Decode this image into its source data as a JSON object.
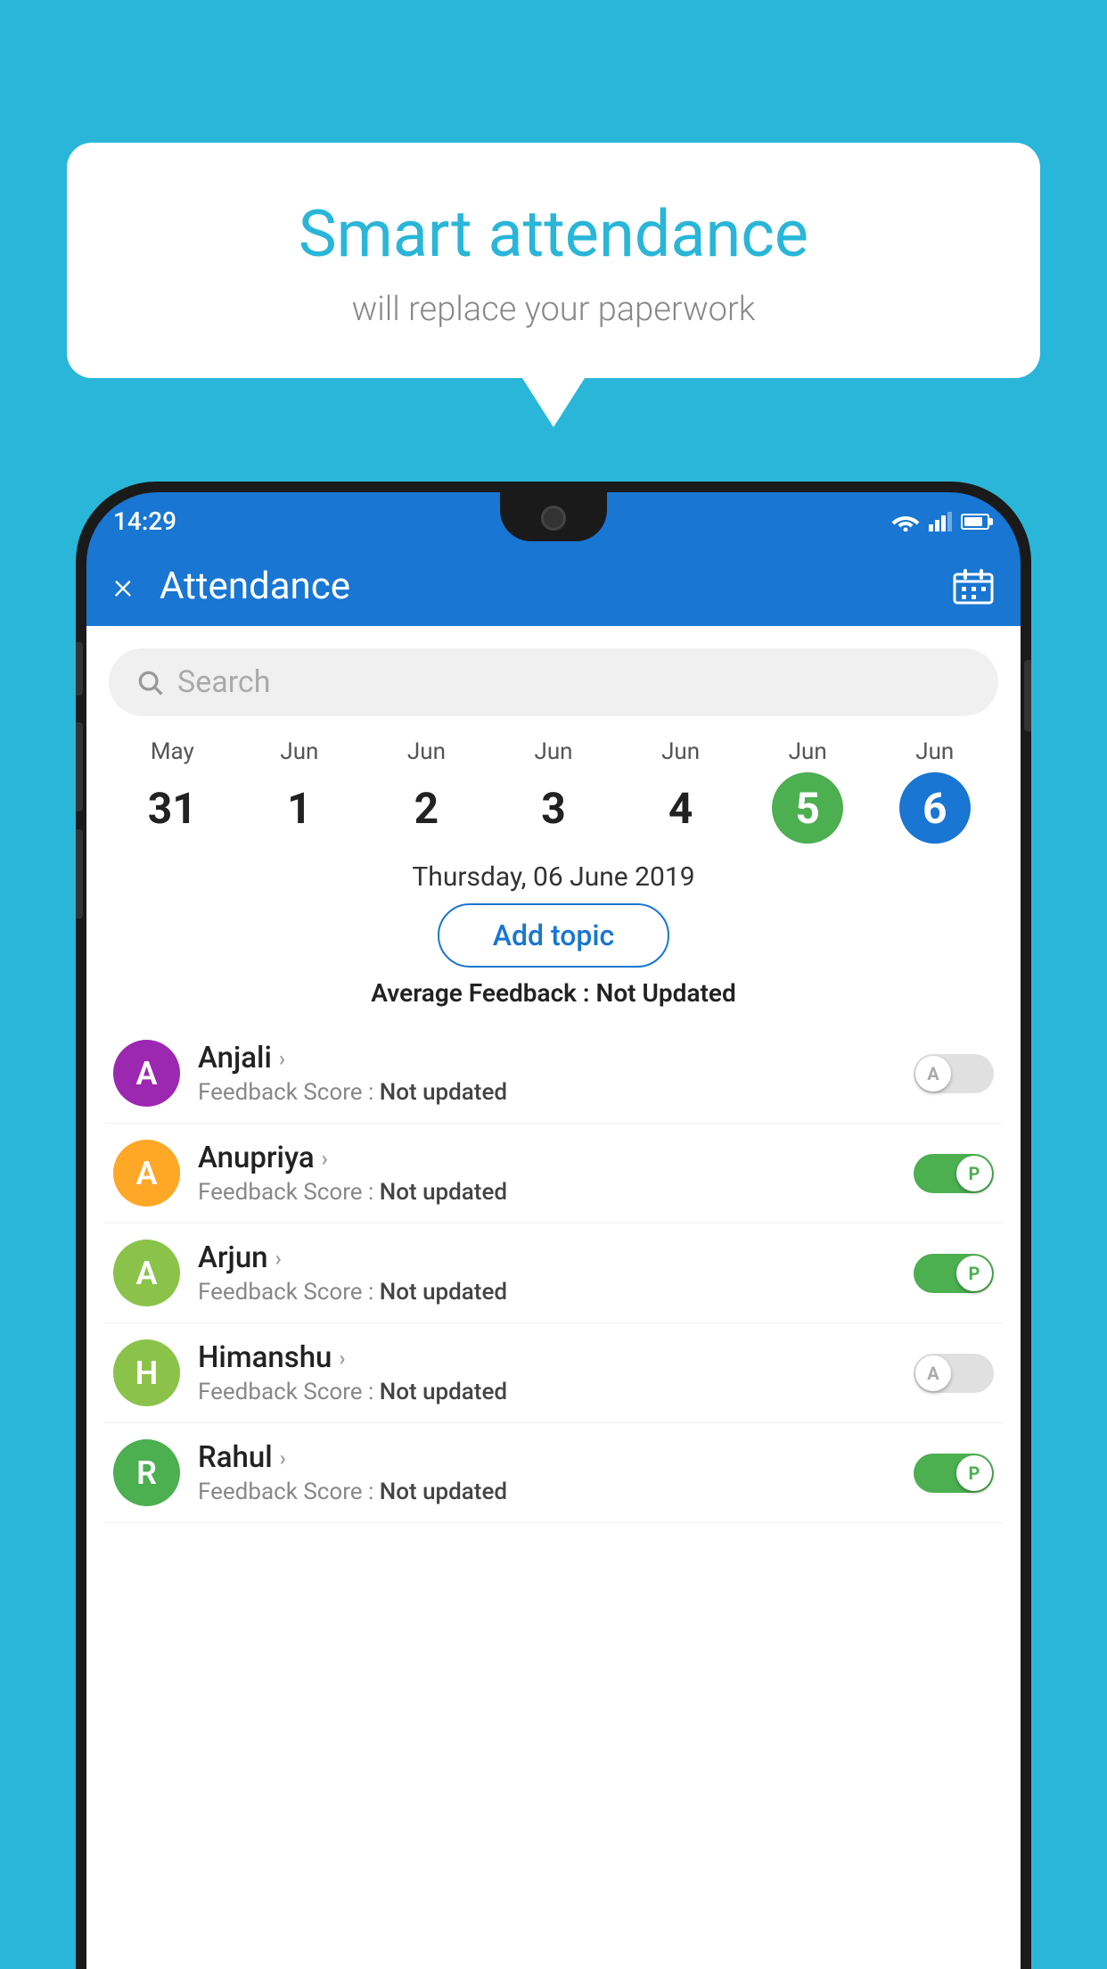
{
  "background_color": "#29B6D8",
  "speech_bubble": {
    "title": "Smart attendance",
    "subtitle": "will replace your paperwork"
  },
  "status_bar": {
    "time": "14:29"
  },
  "app_header": {
    "title": "Attendance",
    "close_label": "×",
    "calendar_icon": "calendar-icon"
  },
  "search": {
    "placeholder": "Search"
  },
  "dates": [
    {
      "month": "May",
      "day": "31",
      "state": "normal"
    },
    {
      "month": "Jun",
      "day": "1",
      "state": "normal"
    },
    {
      "month": "Jun",
      "day": "2",
      "state": "normal"
    },
    {
      "month": "Jun",
      "day": "3",
      "state": "normal"
    },
    {
      "month": "Jun",
      "day": "4",
      "state": "normal"
    },
    {
      "month": "Jun",
      "day": "5",
      "state": "today"
    },
    {
      "month": "Jun",
      "day": "6",
      "state": "selected"
    }
  ],
  "selected_date_label": "Thursday, 06 June 2019",
  "add_topic_button": "Add topic",
  "average_feedback": {
    "label": "Average Feedback : ",
    "value": "Not Updated"
  },
  "students": [
    {
      "name": "Anjali",
      "avatar_letter": "A",
      "avatar_color": "#9C27B0",
      "feedback_label": "Feedback Score : ",
      "feedback_value": "Not updated",
      "toggle_state": "off",
      "toggle_letter": "A"
    },
    {
      "name": "Anupriya",
      "avatar_letter": "A",
      "avatar_color": "#FFA726",
      "feedback_label": "Feedback Score : ",
      "feedback_value": "Not updated",
      "toggle_state": "on",
      "toggle_letter": "P"
    },
    {
      "name": "Arjun",
      "avatar_letter": "A",
      "avatar_color": "#8BC34A",
      "feedback_label": "Feedback Score : ",
      "feedback_value": "Not updated",
      "toggle_state": "on",
      "toggle_letter": "P"
    },
    {
      "name": "Himanshu",
      "avatar_letter": "H",
      "avatar_color": "#8BC34A",
      "feedback_label": "Feedback Score : ",
      "feedback_value": "Not updated",
      "toggle_state": "off",
      "toggle_letter": "A"
    },
    {
      "name": "Rahul",
      "avatar_letter": "R",
      "avatar_color": "#4CAF50",
      "feedback_label": "Feedback Score : ",
      "feedback_value": "Not updated",
      "toggle_state": "on",
      "toggle_letter": "P"
    }
  ]
}
